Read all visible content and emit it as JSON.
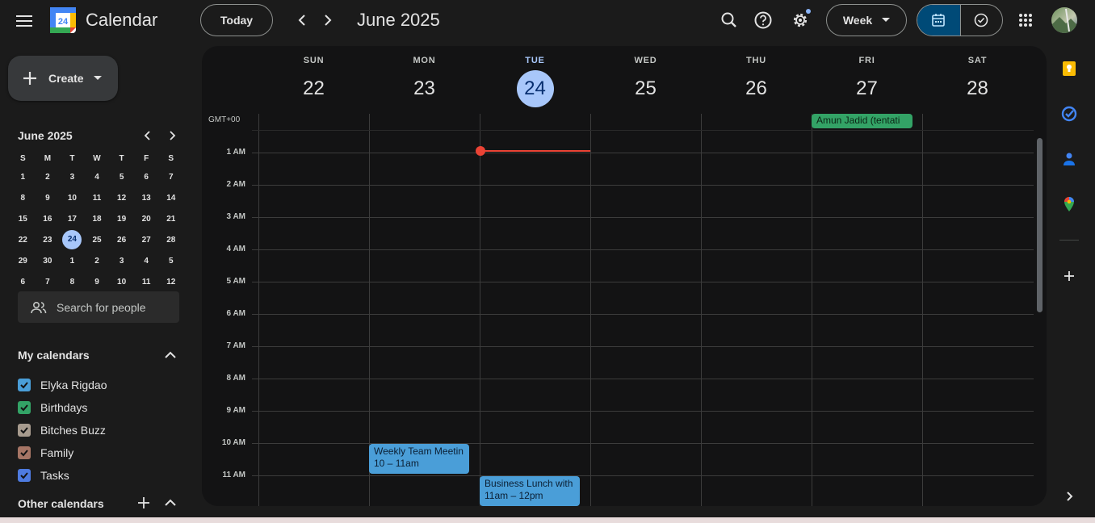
{
  "header": {
    "app_title": "Calendar",
    "logo_day": "24",
    "today_label": "Today",
    "month_title": "June 2025",
    "view_label": "Week"
  },
  "sidebar": {
    "create_label": "Create",
    "mini_month": "June 2025",
    "weekday_initials": [
      "S",
      "M",
      "T",
      "W",
      "T",
      "F",
      "S"
    ],
    "weeks": [
      [
        "1",
        "2",
        "3",
        "4",
        "5",
        "6",
        "7"
      ],
      [
        "8",
        "9",
        "10",
        "11",
        "12",
        "13",
        "14"
      ],
      [
        "15",
        "16",
        "17",
        "18",
        "19",
        "20",
        "21"
      ],
      [
        "22",
        "23",
        "24",
        "25",
        "26",
        "27",
        "28"
      ],
      [
        "29",
        "30",
        "1",
        "2",
        "3",
        "4",
        "5"
      ],
      [
        "6",
        "7",
        "8",
        "9",
        "10",
        "11",
        "12"
      ]
    ],
    "today_day": "24",
    "search_people_placeholder": "Search for people",
    "my_calendars_label": "My calendars",
    "calendars": [
      {
        "name": "Elyka Rigdao",
        "color": "#4a9ed8"
      },
      {
        "name": "Birthdays",
        "color": "#33a366"
      },
      {
        "name": "Bitches Buzz",
        "color": "#a79b8e"
      },
      {
        "name": "Family",
        "color": "#a67565"
      },
      {
        "name": "Tasks",
        "color": "#4e7be0"
      }
    ],
    "other_calendars_label": "Other calendars"
  },
  "week": {
    "days": [
      {
        "dow": "SUN",
        "num": "22"
      },
      {
        "dow": "MON",
        "num": "23"
      },
      {
        "dow": "TUE",
        "num": "24",
        "today": true
      },
      {
        "dow": "WED",
        "num": "25"
      },
      {
        "dow": "THU",
        "num": "26"
      },
      {
        "dow": "FRI",
        "num": "27"
      },
      {
        "dow": "SAT",
        "num": "28"
      }
    ],
    "timezone": "GMT+00",
    "hours": [
      "1 AM",
      "2 AM",
      "3 AM",
      "4 AM",
      "5 AM",
      "6 AM",
      "7 AM",
      "8 AM",
      "9 AM",
      "10 AM",
      "11 AM"
    ],
    "all_day_event": {
      "title": "Amun Jadid (tentati",
      "color": "#33a366"
    },
    "events": [
      {
        "title": "Weekly Team Meetin",
        "time": "10 – 11am",
        "color": "#4a9ed8"
      },
      {
        "title": "Business Lunch with",
        "time": "11am – 12pm",
        "color": "#4a9ed8"
      }
    ]
  },
  "colors": {
    "accent": "#a8c7fa",
    "now_line": "#ea4335",
    "active_view": "#004a77"
  }
}
